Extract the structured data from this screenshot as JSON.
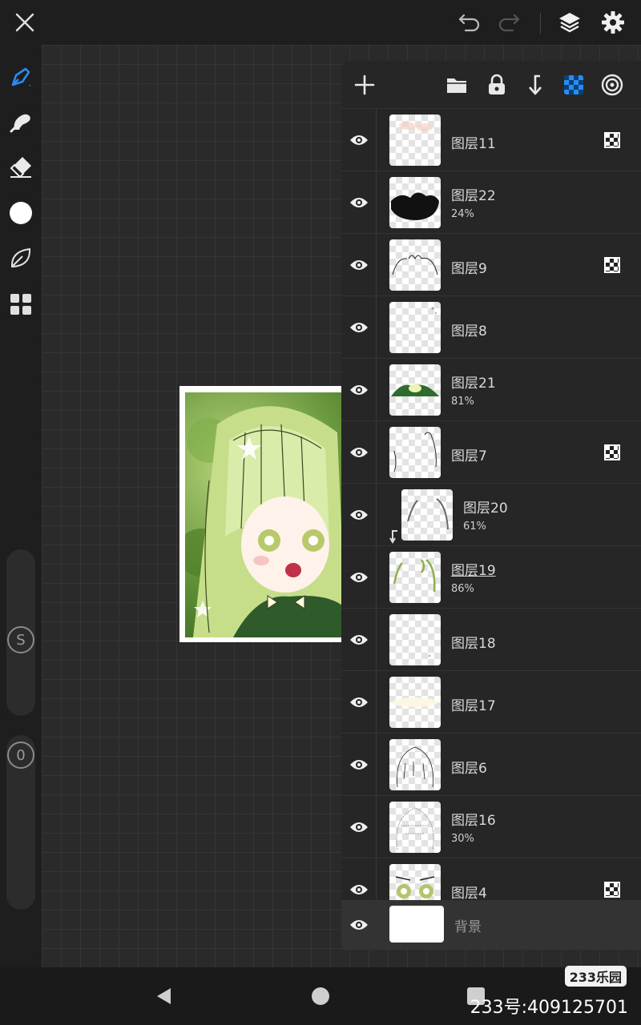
{
  "topbar": {
    "icons": [
      "close-icon",
      "undo-icon",
      "redo-icon",
      "layers-icon",
      "settings-icon"
    ]
  },
  "left_toolbar": {
    "tools": [
      "brush-icon",
      "smudge-icon",
      "eraser-icon",
      "color-icon",
      "leaf-icon",
      "grid-icon"
    ],
    "size_label": "S",
    "opacity_label": "0"
  },
  "layers_panel": {
    "toolbar_icons": [
      "add-layer-icon",
      "folder-icon",
      "lock-icon",
      "merge-down-icon",
      "transparency-icon",
      "reference-icon"
    ],
    "layers": [
      {
        "name": "图层11",
        "opacity": "",
        "blend": true
      },
      {
        "name": "图层22",
        "opacity": "24%",
        "blend": false
      },
      {
        "name": "图层9",
        "opacity": "",
        "blend": true
      },
      {
        "name": "图层8",
        "opacity": "",
        "blend": false
      },
      {
        "name": "图层21",
        "opacity": "81%",
        "blend": false
      },
      {
        "name": "图层7",
        "opacity": "",
        "blend": true
      },
      {
        "name": "图层20",
        "opacity": "61%",
        "blend": false,
        "clipped": true
      },
      {
        "name": "图层19",
        "opacity": "86%",
        "blend": false,
        "selected": true
      },
      {
        "name": "图层18",
        "opacity": "",
        "blend": false
      },
      {
        "name": "图层17",
        "opacity": "",
        "blend": false
      },
      {
        "name": "图层6",
        "opacity": "",
        "blend": false
      },
      {
        "name": "图层16",
        "opacity": "30%",
        "blend": false
      },
      {
        "name": "图层4",
        "opacity": "",
        "blend": true
      }
    ],
    "background_label": "背景"
  },
  "watermark": {
    "logo": "233乐园",
    "id": "233号:409125701"
  }
}
